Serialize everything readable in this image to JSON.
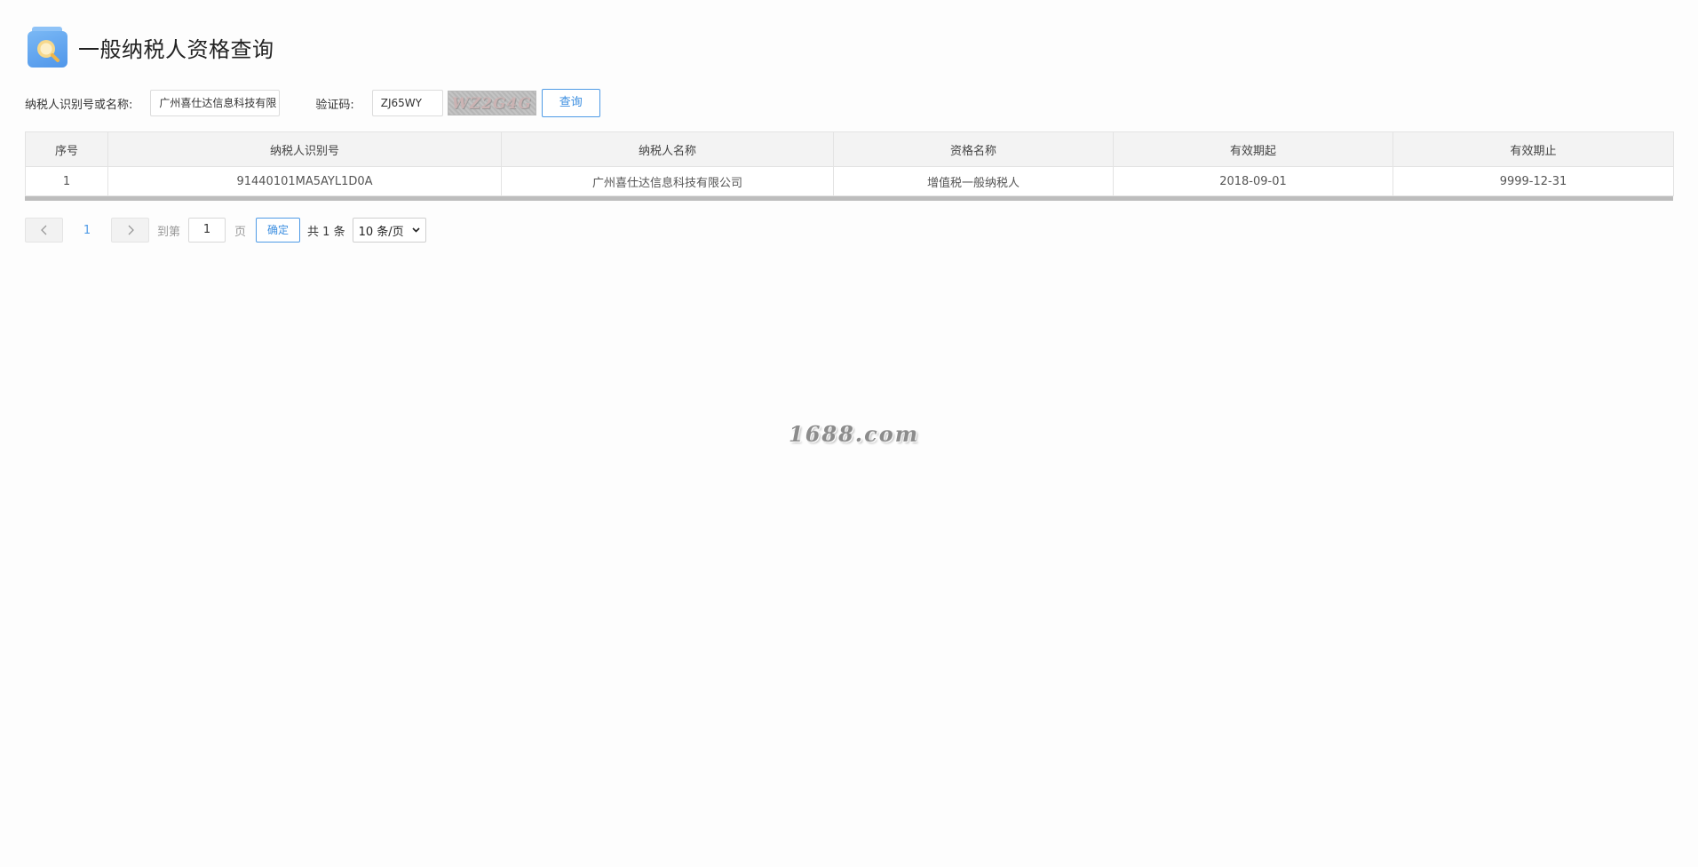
{
  "header": {
    "title": "一般纳税人资格查询",
    "icon": "search-document-icon"
  },
  "search": {
    "taxpayer_label": "纳税人识别号或名称:",
    "taxpayer_value": "广州喜仕达信息科技有限",
    "captcha_label": "验证码:",
    "captcha_value": "ZJ65WY",
    "captcha_image_text": "WZ2G4G",
    "query_button": "查询"
  },
  "table": {
    "columns": [
      "序号",
      "纳税人识别号",
      "纳税人名称",
      "资格名称",
      "有效期起",
      "有效期止"
    ],
    "rows": [
      [
        "1",
        "91440101MA5AYL1D0A",
        "广州喜仕达信息科技有限公司",
        "增值税一般纳税人",
        "2018-09-01",
        "9999-12-31"
      ]
    ]
  },
  "pagination": {
    "current_page": "1",
    "goto_label": "到第",
    "page_input": "1",
    "page_unit": "页",
    "confirm_button": "确定",
    "total_text": "共 1 条",
    "page_size": "10 条/页"
  },
  "watermark": "1688.com",
  "colors": {
    "accent": "#4f9be6",
    "header_bg": "#f3f3f3"
  }
}
